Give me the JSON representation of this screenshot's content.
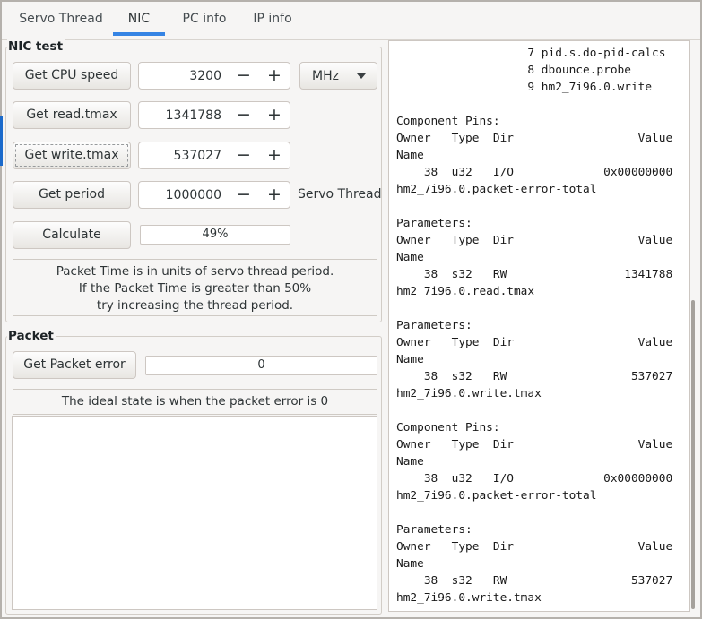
{
  "colors": {
    "accent": "#3584e4",
    "edge_highlight": "#1b6acb"
  },
  "tabs": [
    {
      "label": "Servo Thread",
      "active": false
    },
    {
      "label": "NIC",
      "active": true
    },
    {
      "label": "PC info",
      "active": false
    },
    {
      "label": "IP info",
      "active": false
    }
  ],
  "icons": {
    "minus": "−",
    "plus": "+",
    "dropdown_arrow": "▼"
  },
  "nic": {
    "title": "NIC test",
    "rows": [
      {
        "button": "Get CPU speed",
        "value": "3200",
        "unit": "MHz"
      },
      {
        "button": "Get read.tmax",
        "value": "1341788"
      },
      {
        "button": "Get write.tmax",
        "value": "537027"
      },
      {
        "button": "Get period",
        "value": "1000000",
        "side_label": "Servo Thread"
      }
    ],
    "calculate_label": "Calculate",
    "progress_text": "49%",
    "note": [
      "Packet Time is in units of servo thread period.",
      "If the Packet Time is greater than 50%",
      "try increasing the thread period."
    ]
  },
  "packet": {
    "title": "Packet",
    "button": "Get Packet error",
    "value": "0",
    "note": "The ideal state is when the packet error is 0"
  },
  "output": {
    "lines": [
      "                   7 pid.s.do-pid-calcs",
      "                   8 dbounce.probe",
      "                   9 hm2_7i96.0.write",
      "",
      "Component Pins:",
      "Owner   Type  Dir                  Value",
      "Name",
      "    38  u32   I/O             0x00000000",
      "hm2_7i96.0.packet-error-total",
      "",
      "Parameters:",
      "Owner   Type  Dir                  Value",
      "Name",
      "    38  s32   RW                 1341788",
      "hm2_7i96.0.read.tmax",
      "",
      "Parameters:",
      "Owner   Type  Dir                  Value",
      "Name",
      "    38  s32   RW                  537027",
      "hm2_7i96.0.write.tmax",
      "",
      "Component Pins:",
      "Owner   Type  Dir                  Value",
      "Name",
      "    38  u32   I/O             0x00000000",
      "hm2_7i96.0.packet-error-total",
      "",
      "Parameters:",
      "Owner   Type  Dir                  Value",
      "Name",
      "    38  s32   RW                  537027",
      "hm2_7i96.0.write.tmax"
    ]
  }
}
